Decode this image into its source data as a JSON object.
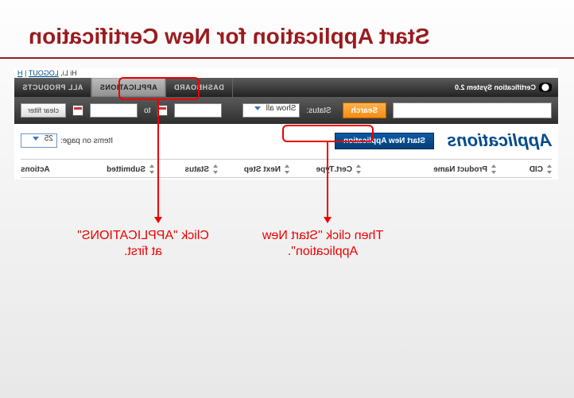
{
  "slide": {
    "title": "Start Application for New Certification"
  },
  "topbar": {
    "greeting": "Hi Li,",
    "logout": "LOGOUT",
    "help_initial": "H"
  },
  "nav": {
    "brand": "Certification System 2.0",
    "tabs": {
      "dashboard": "DASHBOARD",
      "applications": "APPLICATIONS",
      "all_products": "ALL PRODUCTS"
    }
  },
  "search": {
    "button": "Search",
    "status_label": "Status:",
    "status_value": "Show all",
    "to": "to",
    "clear": "clear filter"
  },
  "apps": {
    "heading": "Applications",
    "start_new": "Start New Application",
    "items_on_page_label": "Items on page:",
    "items_on_page_value": "25"
  },
  "columns": {
    "cid": "CID",
    "product_name": "Product Name",
    "cert_type": "Cert.Type",
    "next_step": "Next Step",
    "status": "Status",
    "submitted": "Submitted",
    "actions": "Actions"
  },
  "annotations": {
    "apps_tab": "Click \"APPLICATIONS\" at first.",
    "start_new": "Then click \"Start New Application\"."
  }
}
